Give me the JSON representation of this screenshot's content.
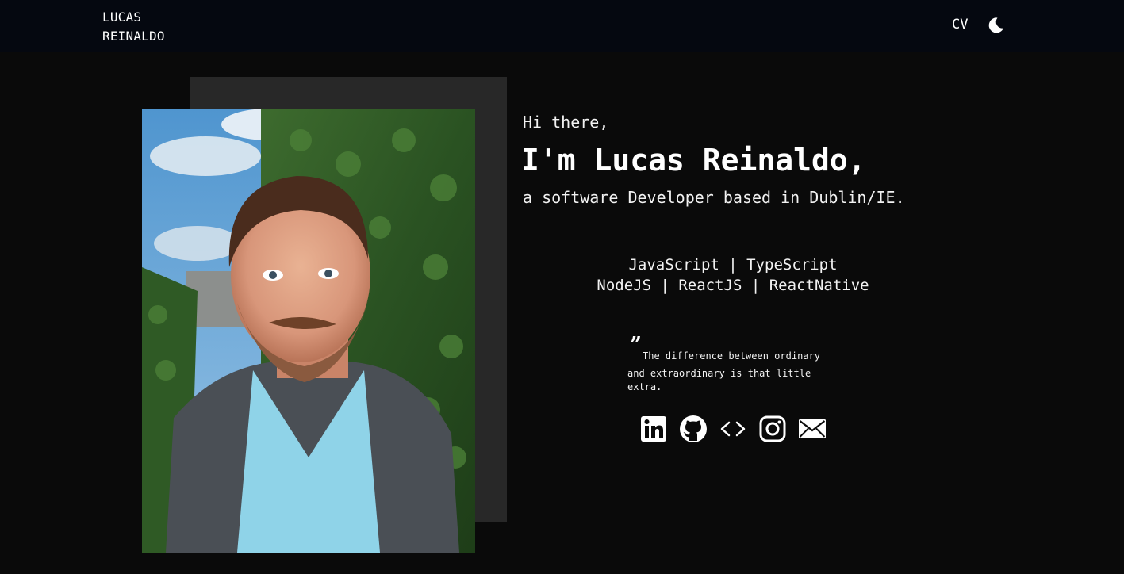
{
  "navbar": {
    "brand": "LUCAS\nREINALDO",
    "cv_label": "CV",
    "theme_toggle_icon": "moon-icon"
  },
  "hero": {
    "greeting": "Hi there,",
    "name": "I'm Lucas Reinaldo,",
    "tagline": "a software Developer based in Dublin/IE.",
    "photo_icon": "profile-photo"
  },
  "skills": {
    "line1": "JavaScript | TypeScript",
    "line2": "NodeJS | ReactJS | ReactNative"
  },
  "quote": {
    "mark": "”",
    "line1": "The difference between ordinary",
    "line2": "and extraordinary is that little extra."
  },
  "socials": [
    {
      "icon": "linkedin-icon"
    },
    {
      "icon": "github-icon"
    },
    {
      "icon": "code-icon"
    },
    {
      "icon": "instagram-icon"
    },
    {
      "icon": "mail-icon"
    }
  ],
  "colors": {
    "background": "#0a0a0a",
    "navbar": "#050810",
    "backdrop": "#282828",
    "text": "#f2f2f2"
  }
}
